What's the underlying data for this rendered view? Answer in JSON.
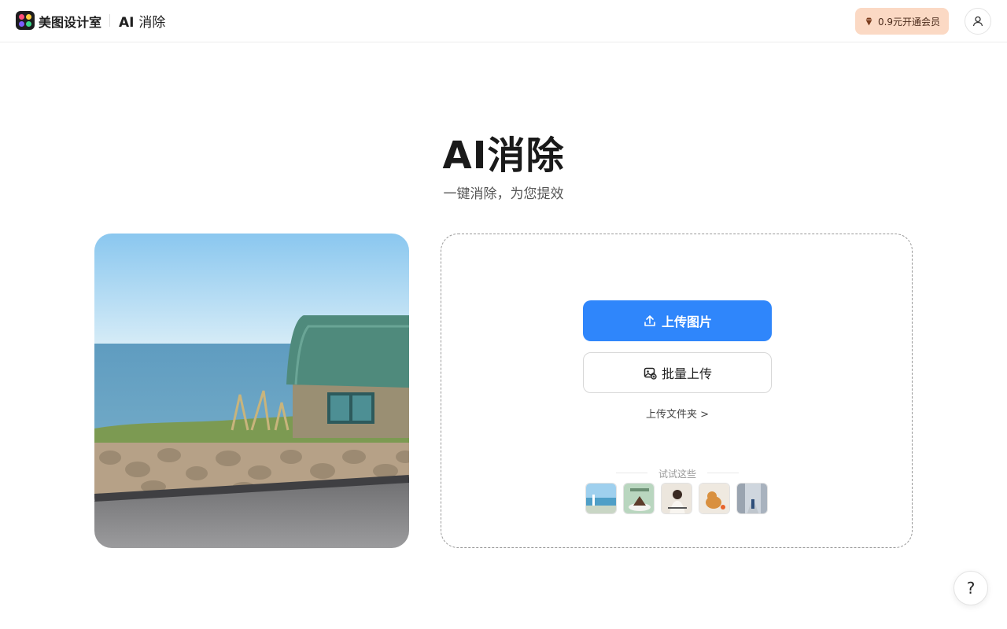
{
  "header": {
    "brand": "美图设计室",
    "tool_prefix": "AI",
    "tool_name": "消除",
    "vip_label": "0.9元开通会员",
    "vip_icon": "diamond-icon",
    "account_icon": "user-icon"
  },
  "hero": {
    "title": "AI消除",
    "subtitle": "一键消除，为您提效"
  },
  "preview": {
    "description_icon": "seaside-house-photo"
  },
  "upload": {
    "primary_label": "上传图片",
    "primary_icon": "upload-icon",
    "batch_label": "批量上传",
    "batch_icon": "batch-images-icon",
    "folder_label": "上传文件夹 >",
    "try_label": "试试这些",
    "samples": [
      "sample-seaside",
      "sample-cake",
      "sample-fashion",
      "sample-cat",
      "sample-street"
    ]
  },
  "help": {
    "label": "?"
  },
  "colors": {
    "accent": "#2f86fb",
    "vip_bg": "#fbd9c4"
  }
}
